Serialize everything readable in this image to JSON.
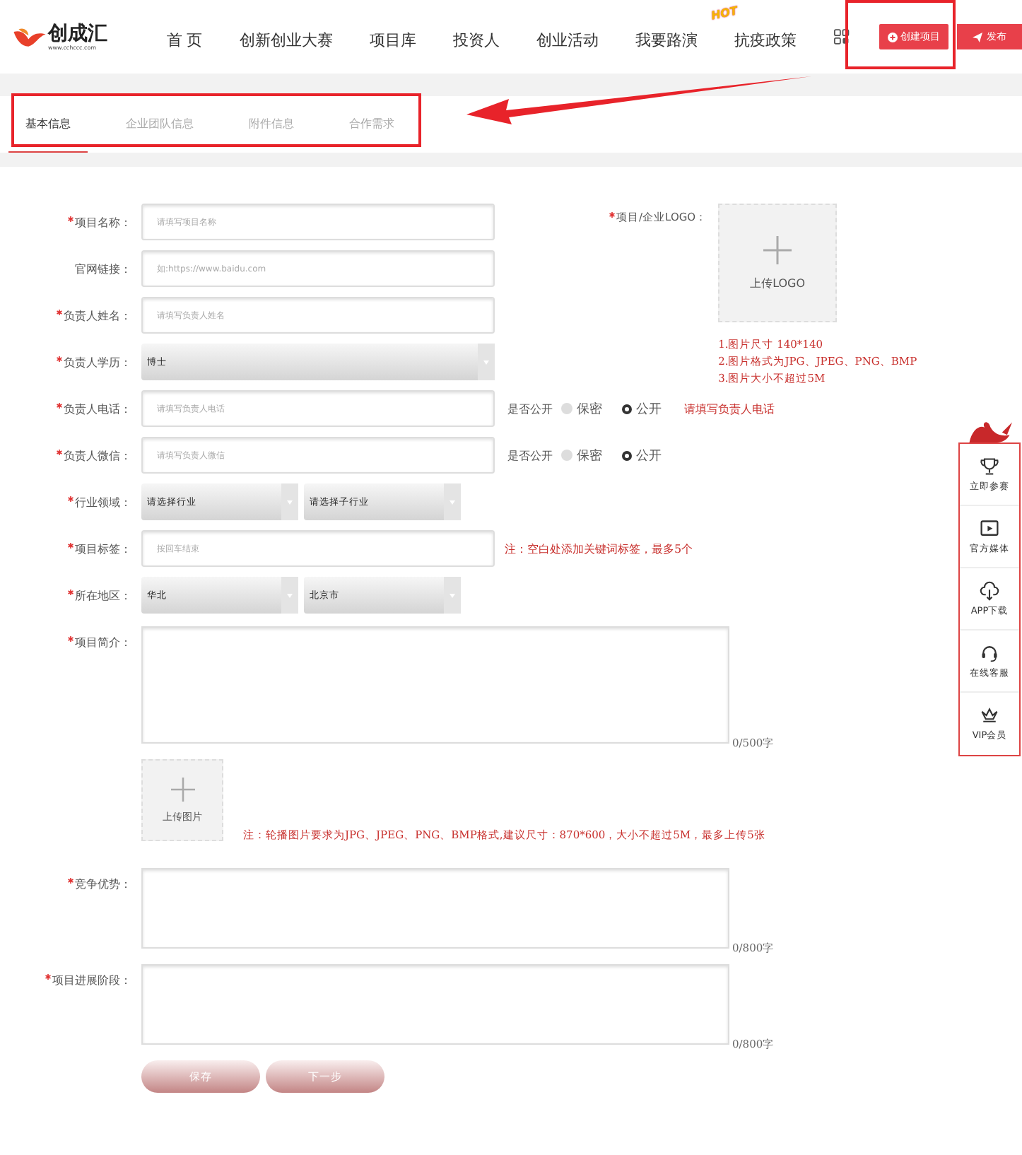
{
  "header": {
    "logo": {
      "name": "创成汇",
      "url": "www.cchccc.com"
    },
    "nav": [
      {
        "label": "首 页"
      },
      {
        "label": "创新创业大赛"
      },
      {
        "label": "项目库"
      },
      {
        "label": "投资人"
      },
      {
        "label": "创业活动"
      },
      {
        "label": "我要路演"
      },
      {
        "label": "抗疫政策",
        "badge": "HOT"
      }
    ],
    "create_button": "创建项目",
    "publish_button": "发布"
  },
  "tabs": [
    {
      "label": "基本信息",
      "selected": true
    },
    {
      "label": "企业团队信息",
      "selected": false
    },
    {
      "label": "附件信息",
      "selected": false
    },
    {
      "label": "合作需求",
      "selected": false
    }
  ],
  "fields_beside_logo": [
    {
      "kind": "text",
      "label": "项目名称：",
      "required": true,
      "placeholder": "请填写项目名称"
    },
    {
      "kind": "text",
      "label": "官网链接：",
      "required": false,
      "placeholder": "如:https://www.baidu.com"
    },
    {
      "kind": "text",
      "label": "负责人姓名：",
      "required": true,
      "placeholder": "请填写负责人姓名"
    },
    {
      "kind": "select",
      "label": "负责人学历：",
      "required": true,
      "value": "博士"
    }
  ],
  "logo_upload": {
    "label": "项目/企业LOGO：",
    "required": true,
    "button": "上传LOGO",
    "notes": [
      "1.图片尺寸 140*140",
      "2.图片格式为JPG、JPEG、PNG、BMP",
      "3.图片大小不超过5M"
    ]
  },
  "fields": [
    {
      "kind": "text",
      "label": "负责人电话：",
      "required": true,
      "placeholder": "请填写负责人电话",
      "privacy": {
        "label": "是否公开",
        "options": [
          {
            "label": "保密",
            "selected": false
          },
          {
            "label": "公开",
            "selected": true
          }
        ]
      },
      "note": "请填写负责人电话"
    },
    {
      "kind": "text",
      "label": "负责人微信：",
      "required": true,
      "placeholder": "请填写负责人微信",
      "privacy": {
        "label": "是否公开",
        "options": [
          {
            "label": "保密",
            "selected": false
          },
          {
            "label": "公开",
            "selected": true
          }
        ]
      }
    },
    {
      "kind": "select_pair",
      "label": "行业领域：",
      "required": true,
      "values": [
        "请选择行业",
        "请选择子行业"
      ]
    },
    {
      "kind": "text",
      "label": "项目标签：",
      "required": true,
      "placeholder": "按回车结束",
      "note": "注：空白处添加关键词标签，最多5个"
    },
    {
      "kind": "select_pair",
      "label": "所在地区：",
      "required": true,
      "values": [
        "华北",
        "北京市"
      ]
    },
    {
      "kind": "textarea",
      "label": "项目简介：",
      "required": true,
      "counter": "0/500字"
    },
    {
      "kind": "upload",
      "button": "上传图片",
      "note": "注：轮播图片要求为JPG、JPEG、PNG、BMP格式,建议尺寸：870*600，大小不超过5M，最多上传5张"
    },
    {
      "kind": "textarea",
      "label": "竞争优势：",
      "required": true,
      "counter": "0/800字"
    },
    {
      "kind": "textarea",
      "label": "项目进展阶段：",
      "required": true,
      "counter": "0/800字"
    }
  ],
  "actions": [
    "保存",
    "下一步"
  ],
  "side_bar": [
    {
      "kind": "trophy",
      "label": "立即参赛"
    },
    {
      "kind": "play",
      "label": "官方媒体"
    },
    {
      "kind": "cloud",
      "label": "APP下载"
    },
    {
      "kind": "headset",
      "label": "在线客服"
    },
    {
      "kind": "crown",
      "label": "VIP会员"
    }
  ]
}
